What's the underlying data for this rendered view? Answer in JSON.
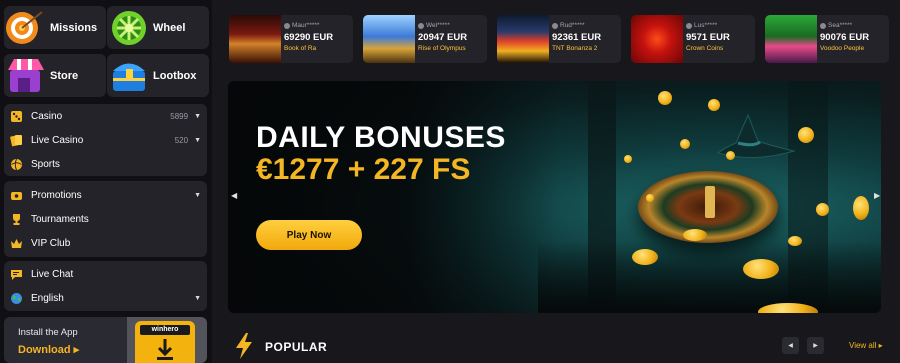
{
  "sidebar": {
    "tiles": [
      {
        "label": "Missions",
        "icon": "target-icon"
      },
      {
        "label": "Wheel",
        "icon": "wheel-icon"
      },
      {
        "label": "Store",
        "icon": "store-icon"
      },
      {
        "label": "Lootbox",
        "icon": "chest-icon"
      }
    ],
    "games": [
      {
        "label": "Casino",
        "count": "5899",
        "icon": "dice-icon"
      },
      {
        "label": "Live Casino",
        "count": "520",
        "icon": "cards-icon"
      },
      {
        "label": "Sports",
        "count": "",
        "icon": "ball-icon"
      }
    ],
    "promos": [
      {
        "label": "Promotions",
        "icon": "promo-icon"
      },
      {
        "label": "Tournaments",
        "icon": "trophy-icon"
      },
      {
        "label": "VIP Club",
        "icon": "crown-icon"
      }
    ],
    "support": [
      {
        "label": "Live Chat",
        "icon": "chat-icon"
      },
      {
        "label": "English",
        "icon": "globe-icon"
      }
    ],
    "install": {
      "title": "Install the App",
      "download": "Download",
      "brand": "winhero"
    }
  },
  "winners": [
    {
      "user": "Maur*****",
      "amount": "69290 EUR",
      "game": "Book of Ra",
      "thumb_color": "#7a1a10"
    },
    {
      "user": "Wel*****",
      "amount": "20947 EUR",
      "game": "Rise of Olympus",
      "thumb_color": "#2a5aa8"
    },
    {
      "user": "Rud*****",
      "amount": "92361 EUR",
      "game": "TNT Bonanza 2",
      "thumb_color": "#1a2a4a"
    },
    {
      "user": "Lus*****",
      "amount": "9571 EUR",
      "game": "Crown Coins",
      "thumb_color": "#b01010"
    },
    {
      "user": "Sea*****",
      "amount": "90076 EUR",
      "game": "Voodoo People",
      "thumb_color": "#1f7a2a"
    }
  ],
  "hero": {
    "title": "DAILY BONUSES",
    "subtitle": "€1277 + 227 FS",
    "cta": "Play Now"
  },
  "popular": {
    "label": "POPULAR",
    "view_all": "View all"
  },
  "colors": {
    "accent": "#f5b623",
    "panel": "#232329",
    "bg": "#17171c"
  }
}
